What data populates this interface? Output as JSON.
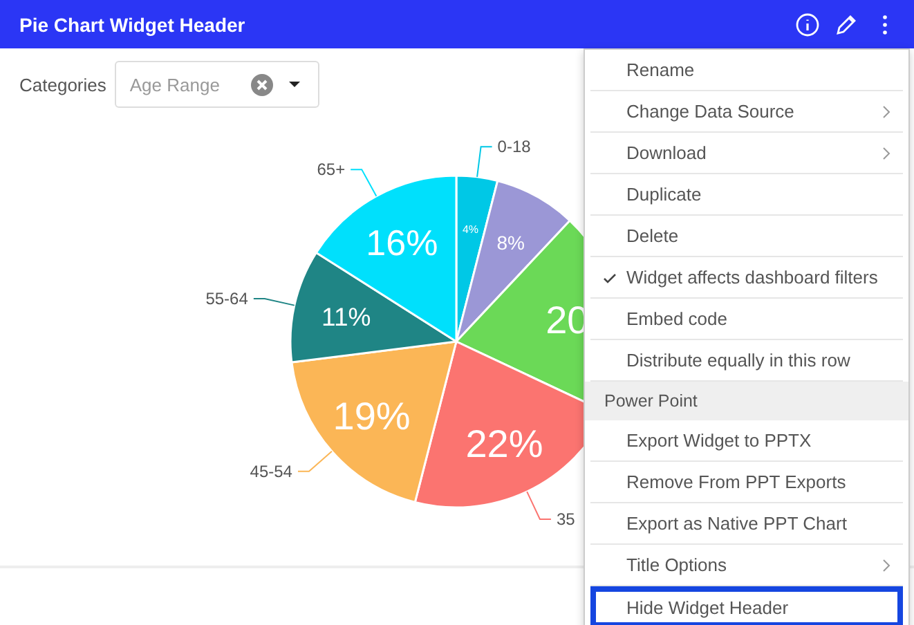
{
  "header": {
    "title": "Pie Chart Widget Header"
  },
  "filter": {
    "label": "Categories",
    "value": "Age Range"
  },
  "chart": {
    "chart_data": {
      "type": "pie",
      "categories": [
        "0-18",
        null,
        null,
        "35",
        "45-54",
        "55-64",
        "65+"
      ],
      "series": [
        {
          "values": [
            4,
            8,
            20,
            22,
            19,
            11,
            16
          ]
        }
      ],
      "colors": [
        "#00c8e6",
        "#9b97d6",
        "#6bd957",
        "#fb7470",
        "#fbb656",
        "#1f8585",
        "#00e0fc"
      ],
      "value_labels": [
        "4%",
        "8%",
        "20",
        "22%",
        "19%",
        "11%",
        "16%"
      ]
    }
  },
  "menu": [
    {
      "kind": "item",
      "label": "Rename",
      "submenu": false,
      "checked": false,
      "selected": false
    },
    {
      "kind": "item",
      "label": "Change Data Source",
      "submenu": true,
      "checked": false,
      "selected": false
    },
    {
      "kind": "item",
      "label": "Download",
      "submenu": true,
      "checked": false,
      "selected": false
    },
    {
      "kind": "item",
      "label": "Duplicate",
      "submenu": false,
      "checked": false,
      "selected": false
    },
    {
      "kind": "item",
      "label": "Delete",
      "submenu": false,
      "checked": false,
      "selected": false
    },
    {
      "kind": "item",
      "label": "Widget affects dashboard filters",
      "submenu": false,
      "checked": true,
      "selected": false
    },
    {
      "kind": "item",
      "label": "Embed code",
      "submenu": false,
      "checked": false,
      "selected": false
    },
    {
      "kind": "item",
      "label": "Distribute equally in this row",
      "submenu": false,
      "checked": false,
      "selected": false
    },
    {
      "kind": "section",
      "label": "Power Point"
    },
    {
      "kind": "item",
      "label": "Export Widget to PPTX",
      "submenu": false,
      "checked": false,
      "selected": false
    },
    {
      "kind": "item",
      "label": "Remove From PPT Exports",
      "submenu": false,
      "checked": false,
      "selected": false
    },
    {
      "kind": "item",
      "label": "Export as Native PPT Chart",
      "submenu": false,
      "checked": false,
      "selected": false
    },
    {
      "kind": "item",
      "label": "Title Options",
      "submenu": true,
      "checked": false,
      "selected": false
    },
    {
      "kind": "item",
      "label": "Hide Widget Header",
      "submenu": false,
      "checked": false,
      "selected": true
    }
  ]
}
